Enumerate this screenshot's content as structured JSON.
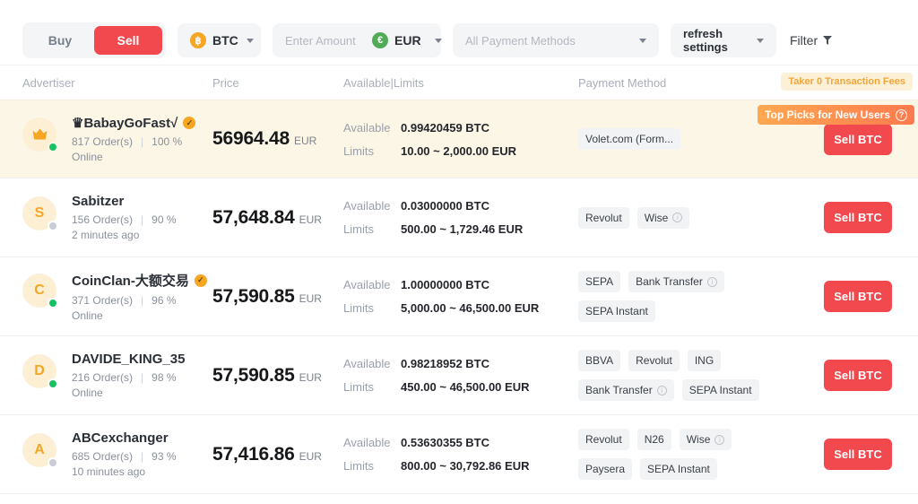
{
  "toolbar": {
    "buy_label": "Buy",
    "sell_label": "Sell",
    "asset": {
      "symbol": "BTC",
      "icon_letter": "฿"
    },
    "amount": {
      "placeholder": "Enter Amount",
      "currency": "EUR",
      "currency_icon": "€"
    },
    "payment_filter_placeholder": "All Payment Methods",
    "refresh_label": "refresh settings",
    "filter_label": "Filter"
  },
  "table": {
    "headers": {
      "advertiser": "Advertiser",
      "price": "Price",
      "available_limits": "Available|Limits",
      "payment": "Payment Method"
    },
    "taker_fee_badge": "Taker 0 Transaction Fees",
    "top_picks_badge": "Top Picks for New Users",
    "labels": {
      "available": "Available",
      "limits": "Limits"
    },
    "action_label": "Sell BTC",
    "rows": [
      {
        "highlighted": true,
        "top_pick": true,
        "avatar": {
          "type": "crown-icon",
          "letter": ""
        },
        "online": true,
        "name": "♛BabayGoFast√",
        "verified": true,
        "orders": "817 Order(s)",
        "completion": "100 %",
        "last_seen": "Online",
        "price": "56964.48",
        "currency": "EUR",
        "available": "0.99420459 BTC",
        "limits": "10.00 ~ 2,000.00 EUR",
        "payments": [
          {
            "label": "Volet.com (Form...",
            "info": false
          }
        ]
      },
      {
        "highlighted": false,
        "top_pick": false,
        "avatar": {
          "type": "letter",
          "letter": "S"
        },
        "online": false,
        "name": "Sabitzer",
        "verified": false,
        "orders": "156 Order(s)",
        "completion": "90 %",
        "last_seen": "2 minutes ago",
        "price": "57,648.84",
        "currency": "EUR",
        "available": "0.03000000 BTC",
        "limits": "500.00 ~ 1,729.46 EUR",
        "payments": [
          {
            "label": "Revolut",
            "info": false
          },
          {
            "label": "Wise",
            "info": true
          }
        ]
      },
      {
        "highlighted": false,
        "top_pick": false,
        "avatar": {
          "type": "letter",
          "letter": "C"
        },
        "online": true,
        "name": "CoinClan-大额交易",
        "verified": true,
        "orders": "371 Order(s)",
        "completion": "96 %",
        "last_seen": "Online",
        "price": "57,590.85",
        "currency": "EUR",
        "available": "1.00000000 BTC",
        "limits": "5,000.00 ~ 46,500.00 EUR",
        "payments": [
          {
            "label": "SEPA",
            "info": false
          },
          {
            "label": "Bank Transfer",
            "info": true
          },
          {
            "label": "SEPA Instant",
            "info": false
          }
        ]
      },
      {
        "highlighted": false,
        "top_pick": false,
        "avatar": {
          "type": "letter",
          "letter": "D"
        },
        "online": true,
        "name": "DAVIDE_KING_35",
        "verified": false,
        "orders": "216 Order(s)",
        "completion": "98 %",
        "last_seen": "Online",
        "price": "57,590.85",
        "currency": "EUR",
        "available": "0.98218952 BTC",
        "limits": "450.00 ~ 46,500.00 EUR",
        "payments": [
          {
            "label": "BBVA",
            "info": false
          },
          {
            "label": "Revolut",
            "info": false
          },
          {
            "label": "ING",
            "info": false
          },
          {
            "label": "Bank Transfer",
            "info": true
          },
          {
            "label": "SEPA Instant",
            "info": false
          }
        ]
      },
      {
        "highlighted": false,
        "top_pick": false,
        "avatar": {
          "type": "letter",
          "letter": "A"
        },
        "online": false,
        "name": "ABCexchanger",
        "verified": false,
        "orders": "685 Order(s)",
        "completion": "93 %",
        "last_seen": "10 minutes ago",
        "price": "57,416.86",
        "currency": "EUR",
        "available": "0.53630355 BTC",
        "limits": "800.00 ~ 30,792.86 EUR",
        "payments": [
          {
            "label": "Revolut",
            "info": false
          },
          {
            "label": "N26",
            "info": false
          },
          {
            "label": "Wise",
            "info": true
          },
          {
            "label": "Paysera",
            "info": false
          },
          {
            "label": "SEPA Instant",
            "info": false
          }
        ]
      }
    ]
  }
}
